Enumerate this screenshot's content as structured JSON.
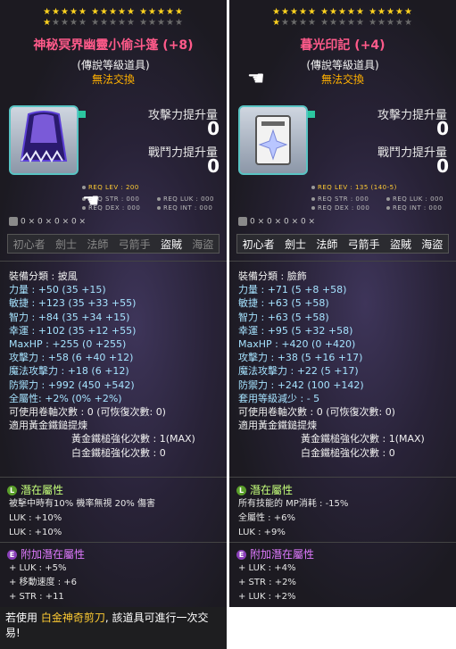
{
  "left": {
    "stars_row1": "★★★★★ ★★★★★ ★★★★★",
    "stars_row2_on": "★",
    "stars_row2_off": "★★★★ ★★★★★ ★★★★★",
    "title": "神秘冥界幽靈小偷斗篷  (+8)",
    "grade": "(傳說等級道具)",
    "untradable": "無法交換",
    "attack_label": "攻擊力提升量",
    "attack_value": "0",
    "combat_label": "戰鬥力提升量",
    "combat_value": "0",
    "req_lev": "REQ LEV : 200",
    "req_str": "REQ STR : 000",
    "req_luk": "REQ LUK : 000",
    "req_dex": "REQ DEX : 000",
    "req_int": "REQ INT : 000",
    "iconrow": "0  ×  0  ×  0  ×  0  ×",
    "jobs": [
      "初心者",
      "劍士",
      "法師",
      "弓箭手",
      "盜賊",
      "海盜"
    ],
    "stats": [
      "裝備分類 : 披風",
      "力量 : +50 (35 +15)",
      "敏捷 : +123 (35 +33 +55)",
      "智力 : +84 (35 +34 +15)",
      "幸運 : +102 (35 +12 +55)",
      "MaxHP : +255 (0 +255)",
      "攻擊力 : +58 (6 +40 +12)",
      "魔法攻擊力 : +18 (6 +12)",
      "防禦力 : +992 (450 +542)",
      "全屬性: +2% (0% +2%)",
      "可使用卷軸次數 : 0 (可恢復次數: 0)",
      "適用黃金鐵鎚提煉",
      "黃金鐵槌強化次數 : 1(MAX)",
      "白金鐵槌強化次數 : 0"
    ],
    "potential_title": "潛在屬性",
    "potential_lines": [
      "被擊中時有10% 機率無視 20% 傷害",
      "LUK : +10%",
      "LUK : +10%"
    ],
    "bonus_title": "附加潛在屬性",
    "bonus_lines": [
      "+ LUK : +5%",
      "+ 移動速度 : +6",
      "+ STR : +11"
    ],
    "footer_a": "若使用 ",
    "footer_hl": "白金神奇剪刀",
    "footer_b": ", 該道具可進行一次交易!"
  },
  "right": {
    "stars_row1": "★★★★★ ★★★★★ ★★★★★",
    "stars_row2_on": "★",
    "stars_row2_off": "★★★★ ★★★★★ ★★★★★",
    "title": "暮光印記  (+4)",
    "grade": "(傳說等級道具)",
    "untradable": "無法交換",
    "attack_label": "攻擊力提升量",
    "attack_value": "0",
    "combat_label": "戰鬥力提升量",
    "combat_value": "0",
    "req_lev": "REQ LEV : 135 (140-5)",
    "req_str": "REQ STR : 000",
    "req_luk": "REQ LUK : 000",
    "req_dex": "REQ DEX : 000",
    "req_int": "REQ INT : 000",
    "iconrow": "0  ×  0  ×  0  ×  0  ×",
    "jobs": [
      "初心者",
      "劍士",
      "法師",
      "弓箭手",
      "盜賊",
      "海盜"
    ],
    "stats": [
      "裝備分類 : 臉飾",
      "力量 : +71 (5 +8 +58)",
      "敏捷 : +63 (5 +58)",
      "智力 : +63 (5 +58)",
      "幸運 : +95 (5 +32 +58)",
      "MaxHP : +420 (0 +420)",
      "攻擊力 : +38 (5 +16 +17)",
      "魔法攻擊力 : +22 (5 +17)",
      "防禦力 : +242 (100 +142)",
      "套用等級減少 : - 5",
      "可使用卷軸次數 : 0 (可恢復次數: 0)",
      "適用黃金鐵鎚提煉",
      "黃金鐵槌強化次數 : 1(MAX)",
      "白金鐵槌強化次數 : 0"
    ],
    "potential_title": "潛在屬性",
    "potential_lines": [
      "所有技能的 MP消耗 : -15%",
      "全屬性 : +6%",
      "LUK : +9%"
    ],
    "bonus_title": "附加潛在屬性",
    "bonus_lines": [
      "+ LUK : +4%",
      "+ STR : +2%",
      "+ LUK : +2%"
    ]
  },
  "colors": {
    "title": "#ff5a8a",
    "untradable": "#ffb000",
    "potential": "#c4ff7a",
    "bonus": "#e07aff",
    "base_value": "#a6e3ff"
  }
}
